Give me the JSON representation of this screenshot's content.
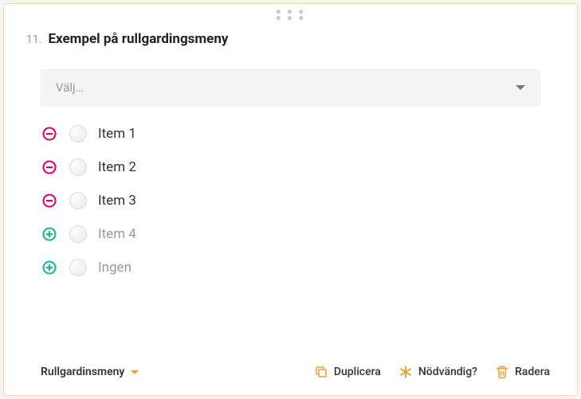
{
  "question": {
    "number": "11.",
    "title": "Exempel på rullgardingsmeny"
  },
  "select": {
    "placeholder": "Välj…"
  },
  "options": [
    {
      "label": "Item 1",
      "mode": "remove",
      "muted": false
    },
    {
      "label": "Item 2",
      "mode": "remove",
      "muted": false
    },
    {
      "label": "Item 3",
      "mode": "remove",
      "muted": false
    },
    {
      "label": "Item 4",
      "mode": "add",
      "muted": true
    },
    {
      "label": "Ingen",
      "mode": "add",
      "muted": true
    }
  ],
  "footer": {
    "type_label": "Rullgardinsmeny",
    "duplicate": "Duplicera",
    "required": "Nödvändig?",
    "delete": "Radera"
  },
  "colors": {
    "remove": "#e5005b",
    "add": "#16b88f",
    "accent": "#f0a030"
  }
}
